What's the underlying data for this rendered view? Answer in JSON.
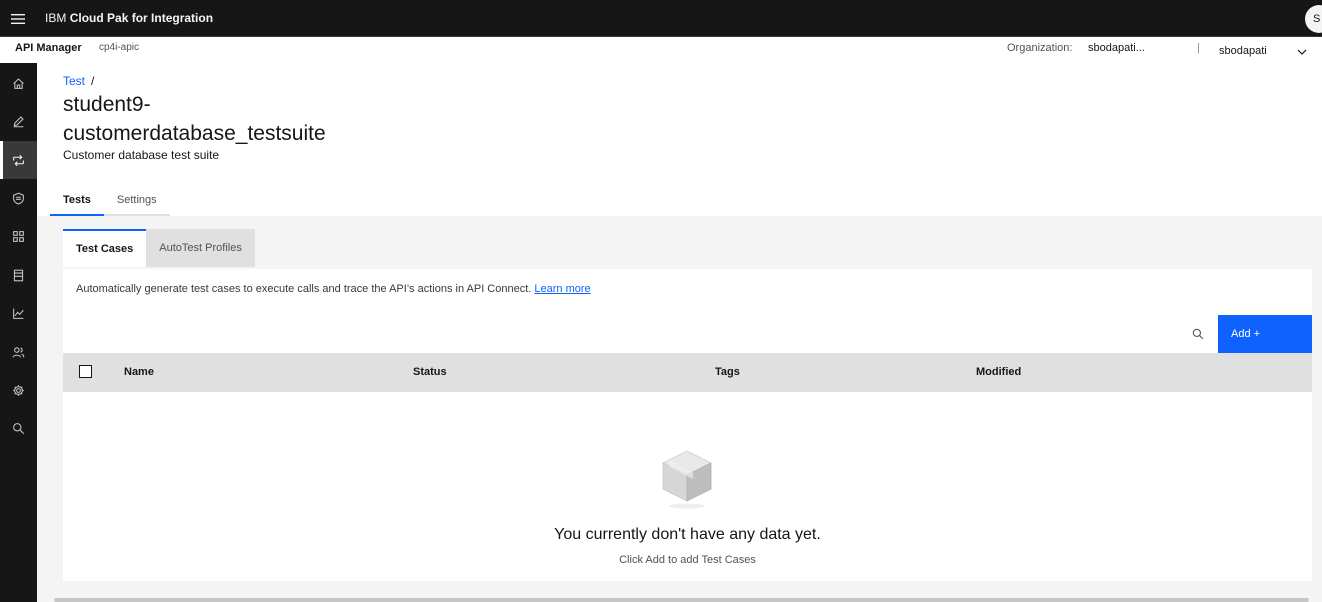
{
  "header": {
    "brand_prefix": "IBM",
    "brand_name": "Cloud Pak for Integration",
    "avatar_initial": "S"
  },
  "subheader": {
    "app_name": "API Manager",
    "instance": "cp4i-apic",
    "org_label": "Organization:",
    "org_value": "sbodapati...",
    "separator": "|",
    "user_name": "sbodapati"
  },
  "sidenav": {
    "items": [
      {
        "icon": "home-icon",
        "active": false
      },
      {
        "icon": "edit-icon",
        "active": false
      },
      {
        "icon": "test-icon",
        "active": true
      },
      {
        "icon": "shield-icon",
        "active": false
      },
      {
        "icon": "apps-icon",
        "active": false
      },
      {
        "icon": "catalog-icon",
        "active": false
      },
      {
        "icon": "analytics-icon",
        "active": false
      },
      {
        "icon": "members-icon",
        "active": false
      },
      {
        "icon": "settings-icon",
        "active": false
      },
      {
        "icon": "search-icon",
        "active": false
      }
    ]
  },
  "page": {
    "breadcrumb_link": "Test",
    "breadcrumb_separator": "/",
    "title": "student9-customerdatabase_testsuite",
    "subtitle": "Customer database test suite"
  },
  "tabs": [
    {
      "label": "Tests",
      "active": true
    },
    {
      "label": "Settings",
      "active": false
    }
  ],
  "subtabs": [
    {
      "label": "Test Cases",
      "active": true
    },
    {
      "label": "AutoTest Profiles",
      "active": false
    }
  ],
  "panel": {
    "description": "Automatically generate test cases to execute calls and trace the API’s actions in API Connect.",
    "learn_more": "Learn more",
    "add_button": "Add +"
  },
  "table": {
    "columns": [
      "Name",
      "Status",
      "Tags",
      "Modified"
    ],
    "rows": []
  },
  "empty_state": {
    "title": "You currently don't have any data yet.",
    "subtitle": "Click Add to add Test Cases"
  },
  "colors": {
    "accent": "#0f62fe",
    "header_bg": "#161616",
    "content_bg": "#f4f4f4"
  }
}
